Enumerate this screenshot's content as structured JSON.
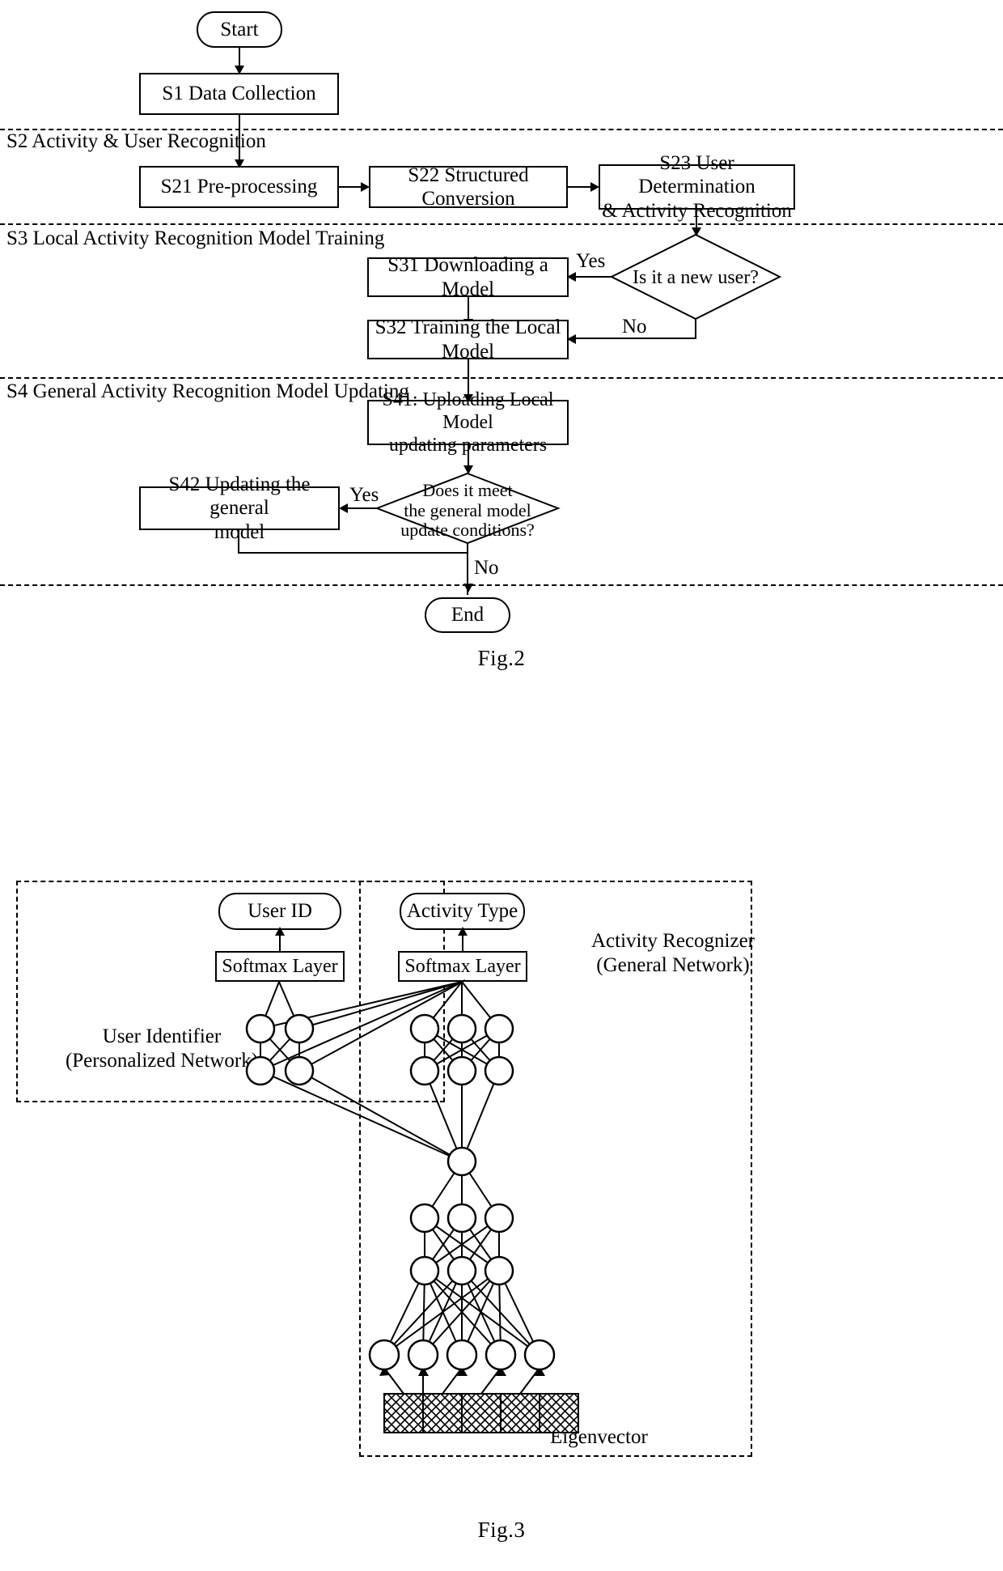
{
  "figures": [
    {
      "id": "fig2",
      "caption": "Fig.2",
      "type": "flowchart",
      "bands": [
        {
          "id": "s2",
          "label": "S2 Activity & User Recognition"
        },
        {
          "id": "s3",
          "label": "S3 Local Activity Recognition Model Training"
        },
        {
          "id": "s4",
          "label": "S4 General Activity Recognition Model Updating"
        }
      ],
      "nodes": {
        "start": "Start",
        "s1": "S1 Data Collection",
        "s21": "S21 Pre-processing",
        "s22": "S22 Structured Conversion",
        "s23_line1": "S23 User Determination",
        "s23_line2": "& Activity Recognition",
        "d1": "Is it a new user?",
        "s31": "S31 Downloading a Model",
        "s32": "S32 Training the Local Model",
        "s41_line1": "S41: Uploading Local Model",
        "s41_line2": "updating parameters",
        "d2_line1": "Does it meet",
        "d2_line2": "the general model",
        "d2_line3": "update conditions?",
        "s42_line1": "S42 Updating the general",
        "s42_line2": "model",
        "end": "End"
      },
      "edge_labels": {
        "d1_yes": "Yes",
        "d1_no": "No",
        "d2_yes": "Yes",
        "d2_no": "No"
      }
    },
    {
      "id": "fig3",
      "caption": "Fig.3",
      "type": "neural-network",
      "regions": [
        {
          "id": "user_identifier",
          "line1": "User Identifier",
          "line2": "(Personalized Network)"
        },
        {
          "id": "activity_recognizer",
          "line1": "Activity Recognizer",
          "line2": "(General Network)"
        }
      ],
      "nodes": {
        "user_id": "User ID",
        "activity_type": "Activity Type",
        "softmax_left": "Softmax Layer",
        "softmax_right": "Softmax Layer",
        "eigenvector": "Eigenvector"
      },
      "network": {
        "personalized_layers": [
          2,
          2
        ],
        "general_layers": [
          3,
          3,
          1,
          3,
          3,
          5
        ],
        "eigenvector_cells": 5
      }
    }
  ],
  "colors": {
    "stroke": "#000000",
    "background": "#ffffff"
  }
}
